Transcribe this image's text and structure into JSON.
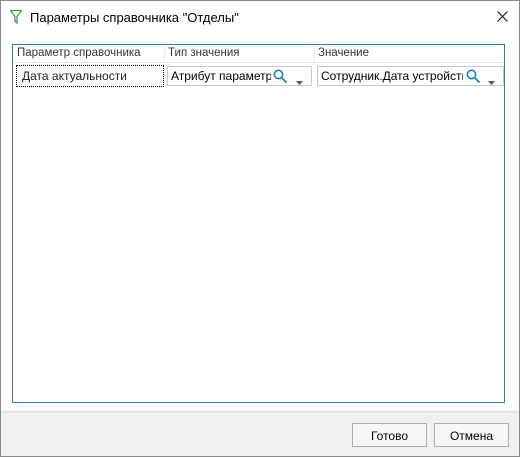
{
  "window": {
    "title": "Параметры справочника \"Отделы\"",
    "icon": "filter-funnel-icon",
    "close": "close-icon"
  },
  "grid": {
    "columns": [
      "Параметр справочника",
      "Тип значения",
      "Значение"
    ],
    "rows": [
      {
        "parameter": "Дата актуальности",
        "value_type": "Атрибут параметра",
        "value": "Сотрудник.Дата устройства"
      }
    ],
    "accent": "#2e7db5"
  },
  "buttons": {
    "ok": "Готово",
    "cancel": "Отмена"
  },
  "icons": {
    "search": "search-icon",
    "dropdown": "chevron-down-icon"
  }
}
